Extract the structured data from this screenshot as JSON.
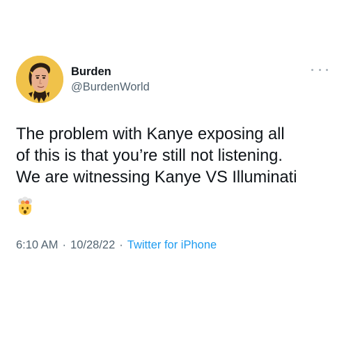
{
  "author": {
    "display_name": "Burden",
    "handle": "@BurdenWorld",
    "avatar_icon": "cartoon-portrait-avatar"
  },
  "tweet": {
    "text_lines": [
      "The problem with Kanye exposing all",
      "of this is that you’re still not listening.",
      "We are witnessing Kanye VS Illuminati"
    ],
    "emoji": "exploding-head-emoji"
  },
  "meta": {
    "time": "6:10 AM",
    "separator": "·",
    "date": "10/28/22",
    "source": "Twitter for iPhone"
  },
  "colors": {
    "text": "#0f1419",
    "secondary": "#536471",
    "link": "#1d9bf0",
    "avatar_bg": "#f0c24a"
  },
  "icons": {
    "more": "more-dots-icon"
  }
}
